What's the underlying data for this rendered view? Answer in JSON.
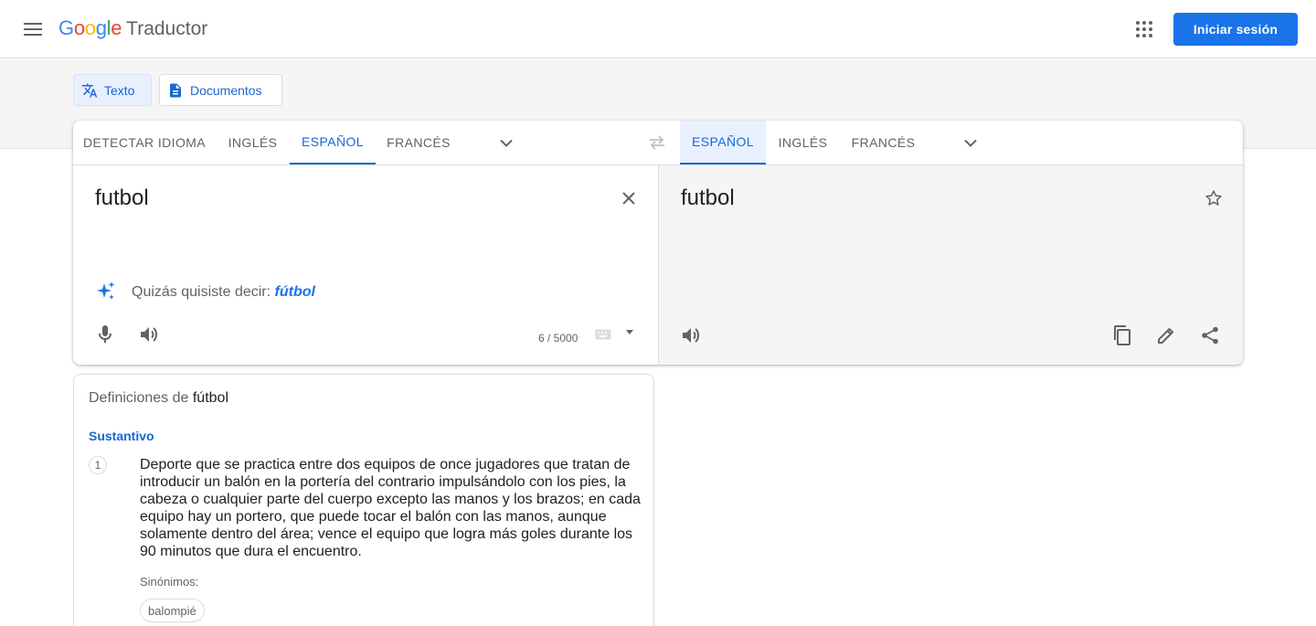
{
  "header": {
    "logo_google": [
      "G",
      "o",
      "o",
      "g",
      "l",
      "e"
    ],
    "logo_colors": [
      "#4285f4",
      "#ea4335",
      "#fbbc05",
      "#4285f4",
      "#34a853",
      "#ea4335"
    ],
    "product": "Traductor",
    "signin_label": "Iniciar sesión",
    "accent": "#1a73e8"
  },
  "modes": [
    {
      "label": "Texto",
      "icon": "translate-icon",
      "active": true
    },
    {
      "label": "Documentos",
      "icon": "document-icon",
      "active": false
    }
  ],
  "source_langs": {
    "tabs": [
      "DETECTAR IDIOMA",
      "INGLÉS",
      "ESPAÑOL",
      "FRANCÉS"
    ],
    "selected": "ESPAÑOL"
  },
  "target_langs": {
    "tabs": [
      "ESPAÑOL",
      "INGLÉS",
      "FRANCÉS"
    ],
    "selected": "ESPAÑOL"
  },
  "source": {
    "text": "futbol",
    "suggestion_prefix": "Quizás quisiste decir:",
    "suggestion_word": "fútbol",
    "char_count": "6 / 5000"
  },
  "target": {
    "text": "futbol"
  },
  "definitions": {
    "title_prefix": "Definiciones de",
    "term": "fútbol",
    "part_of_speech": "Sustantivo",
    "entries": [
      {
        "number": "1",
        "text": "Deporte que se practica entre dos equipos de once jugadores que tratan de introducir un balón en la portería del contrario impulsándolo con los pies, la cabeza o cualquier parte del cuerpo excepto las manos y los brazos; en cada equipo hay un portero, que puede tocar el balón con las manos, aunque solamente dentro del área; vence el equipo que logra más goles durante los 90 minutos que dura el encuentro.",
        "synonyms_label": "Sinónimos:",
        "synonyms": [
          "balompié"
        ]
      }
    ]
  }
}
